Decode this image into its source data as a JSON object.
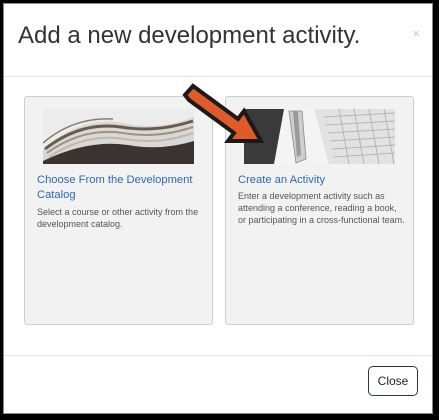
{
  "modal": {
    "title": "Add a new development activity.",
    "close_glyph": "×",
    "close_icon": "close-icon"
  },
  "options": [
    {
      "title": "Choose From the Development Catalog",
      "description": "Select a course or other activity from the development catalog.",
      "image": "open-book-image"
    },
    {
      "title": "Create an Activity",
      "description": "Enter a development activity such as attending a conference, reading a book, or participating in a cross-functional team.",
      "image": "pen-and-keyboard-image"
    }
  ],
  "footer": {
    "close_label": "Close"
  },
  "annotation": {
    "icon": "pointer-arrow",
    "fill_color": "#e15a2a",
    "outline_color": "#1a1a1a"
  },
  "colors": {
    "link_blue": "#2a6ab1",
    "card_background": "#f2f2f2",
    "button_border": "#1f3a57"
  }
}
